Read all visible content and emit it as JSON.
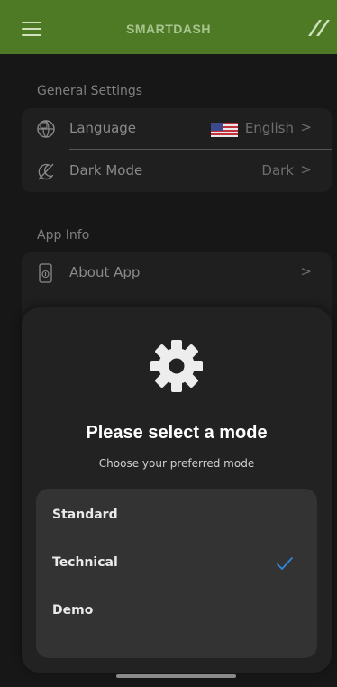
{
  "header": {
    "title": "SMARTDASH",
    "menu_icon": "hamburger-menu-icon",
    "logo_icon": "brand-slash-logo-icon",
    "color": "#4e7a25"
  },
  "general_settings": {
    "title": "General Settings",
    "items": [
      {
        "icon": "language-globe-icon",
        "label": "Language",
        "value": "English",
        "flag": "us-flag"
      },
      {
        "icon": "dark-mode-icon",
        "label": "Dark Mode",
        "value": "Dark"
      }
    ]
  },
  "app_info": {
    "title": "App Info",
    "items": [
      {
        "icon": "phone-info-icon",
        "label": "About App",
        "value": ""
      }
    ]
  },
  "mode_sheet": {
    "icon": "gear-icon",
    "title": "Please select a mode",
    "subtitle": "Choose your preferred mode",
    "options": [
      {
        "label": "Standard",
        "selected": false
      },
      {
        "label": "Technical",
        "selected": true
      },
      {
        "label": "Demo",
        "selected": false
      }
    ],
    "check_color": "#2f87d8"
  },
  "chevron": ">"
}
